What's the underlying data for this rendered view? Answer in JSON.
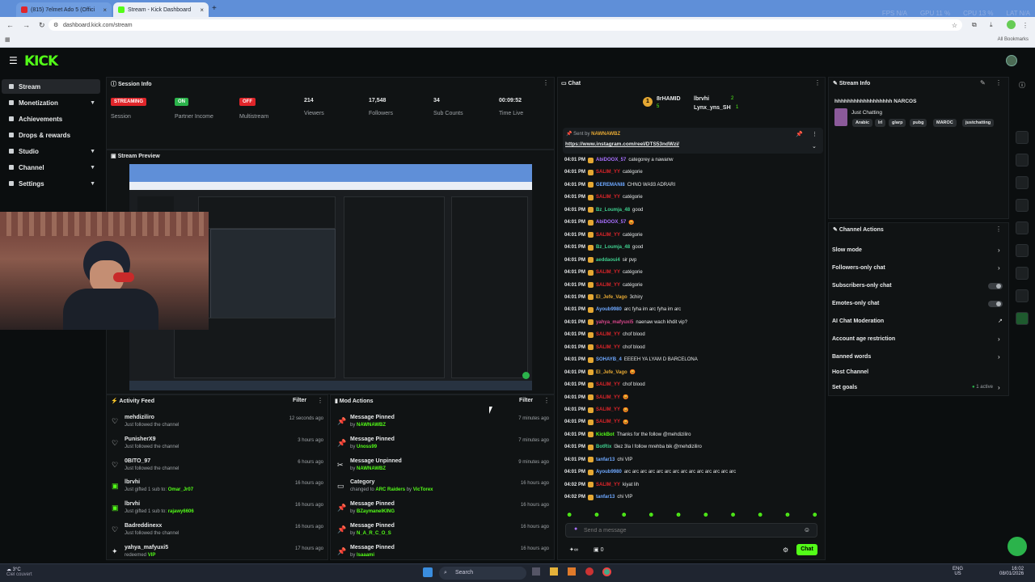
{
  "browser": {
    "tabs": [
      {
        "title": "(815) 7elmet Ado 5 (Offici",
        "active": false
      },
      {
        "title": "Stream - Kick Dashboard",
        "active": true
      }
    ],
    "hud": [
      "FPS N/A",
      "GPU 11 %",
      "CPU 13 %",
      "LAT N/A"
    ],
    "url": "dashboard.kick.com/stream",
    "all_bookmarks": "All Bookmarks"
  },
  "brand": {
    "logo": "KICK",
    "accent": "#53fc18"
  },
  "sidebar": {
    "items": [
      {
        "label": "Stream",
        "selected": true,
        "chevron": false
      },
      {
        "label": "Monetization",
        "chevron": true
      },
      {
        "label": "Achievements",
        "chevron": false
      },
      {
        "label": "Drops & rewards",
        "chevron": false
      },
      {
        "label": "Studio",
        "chevron": true
      },
      {
        "label": "Channel",
        "chevron": true
      },
      {
        "label": "Settings",
        "chevron": true
      }
    ]
  },
  "session": {
    "title": "Session Info",
    "stats": [
      {
        "badge": "STREAMING",
        "badge_color": "#e0252a",
        "label": "Session"
      },
      {
        "badge": "ON",
        "badge_color": "#2bb34b",
        "label": "Partner Income"
      },
      {
        "badge": "OFF",
        "badge_color": "#e0252a",
        "label": "Multistream"
      },
      {
        "value": "214",
        "label": "Viewers"
      },
      {
        "value": "17,548",
        "label": "Followers"
      },
      {
        "value": "34",
        "label": "Sub Counts"
      },
      {
        "value": "00:09:52",
        "label": "Time Live"
      }
    ]
  },
  "preview": {
    "title": "Stream Preview"
  },
  "activity": {
    "title": "Activity Feed",
    "filter": "Filter",
    "items": [
      {
        "icon": "heart",
        "name": "mehdiziliro",
        "sub": "Just followed the channel",
        "time": "12 seconds ago"
      },
      {
        "icon": "heart",
        "name": "PunisherX9",
        "sub": "Just followed the channel",
        "time": "3 hours ago"
      },
      {
        "icon": "heart",
        "name": "0BITO_97",
        "sub": "Just followed the channel",
        "time": "6 hours ago"
      },
      {
        "icon": "gift",
        "name": "lbrvhi",
        "sub_prefix": "Just gifted 1 sub to: ",
        "sub_target": "Omar_Jr07",
        "time": "16 hours ago"
      },
      {
        "icon": "gift",
        "name": "lbrvhi",
        "sub_prefix": "Just gifted 1 sub to: ",
        "sub_target": "rajawy6606",
        "time": "16 hours ago"
      },
      {
        "icon": "heart",
        "name": "Badreddinexx",
        "sub": "Just followed the channel",
        "time": "16 hours ago"
      },
      {
        "icon": "gift",
        "name": "yahya_mafyuxi5",
        "sub_prefix": "redeemed ",
        "sub_target": "VIP",
        "time": "17 hours ago"
      }
    ]
  },
  "mod": {
    "title": "Mod Actions",
    "filter": "Filter",
    "items": [
      {
        "icon": "pin",
        "name": "Message Pinned",
        "by": "by ",
        "target": "NAWNAWBZ",
        "time": "7 minutes ago"
      },
      {
        "icon": "pin",
        "name": "Message Pinned",
        "by": "by ",
        "target": "Unoss99",
        "time": "7 minutes ago"
      },
      {
        "icon": "unpin",
        "name": "Message Unpinned",
        "by": "by ",
        "target": "NAWNAWBZ",
        "time": "9 minutes ago"
      },
      {
        "icon": "category",
        "name": "Category",
        "by": "changed to ",
        "target": "ARC Raiders",
        "by2": " by ",
        "target2": "VicTorex",
        "time": "16 hours ago"
      },
      {
        "icon": "pin",
        "name": "Message Pinned",
        "by": "by ",
        "target": "BZaymanelKING",
        "time": "16 hours ago"
      },
      {
        "icon": "pin",
        "name": "Message Pinned",
        "by": "by ",
        "target": "N_A_R_C_O_S",
        "time": "16 hours ago"
      },
      {
        "icon": "pin",
        "name": "Message Pinned",
        "by": "by ",
        "target": "lsaaami",
        "time": "16 hours ago"
      }
    ]
  },
  "chat": {
    "title": "Chat",
    "top_gifter": {
      "rank": "1",
      "name": "8rHAMID",
      "count": "5"
    },
    "leader2": {
      "name": "lbrvhi",
      "count": "2"
    },
    "leader3": {
      "name": "Lynx_yns_SH",
      "count": "1"
    },
    "pinned_by": "Sent by",
    "pinned_user": "NAWNAWBZ",
    "pinned_link": "https://www.instagram.com/reel/DTS53ndWzi/",
    "messages": [
      {
        "t": "04:01 PM",
        "u": "AbiDOOX_57",
        "c": "#a970ff",
        "m": "categorey a nawanw"
      },
      {
        "t": "04:01 PM",
        "u": "SALIM_YY",
        "c": "#e0252a",
        "m": "catégorie"
      },
      {
        "t": "04:01 PM",
        "u": "GEREMANI8",
        "c": "#6ea8ff",
        "m": "CHNO WA93 ADRARI"
      },
      {
        "t": "04:01 PM",
        "u": "SALIM_YY",
        "c": "#e0252a",
        "m": "catégorie"
      },
      {
        "t": "04:01 PM",
        "u": "Bz_Loumja_48",
        "c": "#3fcf8e",
        "m": "good"
      },
      {
        "t": "04:01 PM",
        "u": "AbiDOOX_57",
        "c": "#a970ff",
        "m": "😡"
      },
      {
        "t": "04:01 PM",
        "u": "SALIM_YY",
        "c": "#e0252a",
        "m": "catégorie"
      },
      {
        "t": "04:01 PM",
        "u": "Bz_Loumja_48",
        "c": "#3fcf8e",
        "m": "good"
      },
      {
        "t": "04:01 PM",
        "u": "aeddaoui4",
        "c": "#3fcf8e",
        "m": "sir pvp"
      },
      {
        "t": "04:01 PM",
        "u": "SALIM_YY",
        "c": "#e0252a",
        "m": "catégorie"
      },
      {
        "t": "04:01 PM",
        "u": "SALIM_YY",
        "c": "#e0252a",
        "m": "catégorie"
      },
      {
        "t": "04:01 PM",
        "u": "El_Jefe_Vago",
        "c": "#e5a833",
        "m": "3chiry"
      },
      {
        "t": "04:01 PM",
        "u": "Ayoub9980",
        "c": "#6ea8ff",
        "m": "arc fyha im arc fyha im arc"
      },
      {
        "t": "04:01 PM",
        "u": "yahya_mafyuxi5",
        "c": "#d9468b",
        "m": "naenaw wach khdit vip?"
      },
      {
        "t": "04:01 PM",
        "u": "SALIM_YY",
        "c": "#e0252a",
        "m": "chof blood"
      },
      {
        "t": "04:01 PM",
        "u": "SALIM_YY",
        "c": "#e0252a",
        "m": "chof blood"
      },
      {
        "t": "04:01 PM",
        "u": "SOHAYB_4",
        "c": "#6ea8ff",
        "m": "EEEEH YA LYAM D BARCELONA"
      },
      {
        "t": "04:01 PM",
        "u": "El_Jefe_Vago",
        "c": "#e5a833",
        "m": "😡"
      },
      {
        "t": "04:01 PM",
        "u": "SALIM_YY",
        "c": "#e0252a",
        "m": "chof blood"
      },
      {
        "t": "04:01 PM",
        "u": "SALIM_YY",
        "c": "#e0252a",
        "m": "😡"
      },
      {
        "t": "04:01 PM",
        "u": "SALIM_YY",
        "c": "#e0252a",
        "m": "😡"
      },
      {
        "t": "04:01 PM",
        "u": "SALIM_YY",
        "c": "#e0252a",
        "m": "😡"
      },
      {
        "t": "04:01 PM",
        "u": "KickBot",
        "c": "#53fc18",
        "m": "Thanks for the follow @mehdiziliro"
      },
      {
        "t": "04:01 PM",
        "u": "BotRix",
        "c": "#3fcf8e",
        "m": "l3ez 3la l follow mrehba bik @mehdiziliro"
      },
      {
        "t": "04:01 PM",
        "u": "tanfar13",
        "c": "#6ea8ff",
        "m": "chi VIP"
      },
      {
        "t": "04:01 PM",
        "u": "Ayoub9980",
        "c": "#6ea8ff",
        "m": "arc arc arc arc arc arc arc arc arc arc arc arc arc arc"
      },
      {
        "t": "04:02 PM",
        "u": "SALIM_YY",
        "c": "#e0252a",
        "m": "kiyat lih"
      },
      {
        "t": "04:02 PM",
        "u": "tanfar13",
        "c": "#6ea8ff",
        "m": "chi VIP"
      }
    ],
    "input_placeholder": "Send a message",
    "send_label": "Chat",
    "count": "0"
  },
  "stream_info": {
    "title": "Stream Info",
    "stream_title": "hhhhhhhhhhhhhhhhhh NARCOS",
    "category": "Just Chatting",
    "tags": [
      "Arabic",
      "lrl",
      "glarp",
      "pubg",
      "MAROC",
      "justchatting"
    ]
  },
  "channel_actions": {
    "title": "Channel Actions",
    "items": [
      {
        "label": "Slow mode",
        "control": "arrow"
      },
      {
        "label": "Followers-only chat",
        "control": "arrow"
      },
      {
        "label": "Subscribers-only chat",
        "control": "toggle"
      },
      {
        "label": "Emotes-only chat",
        "control": "toggle"
      },
      {
        "label": "AI Chat Moderation",
        "control": "link"
      },
      {
        "label": "Account age restriction",
        "control": "arrow"
      },
      {
        "label": "Banned words",
        "control": "arrow"
      },
      {
        "label": "Host Channel",
        "control": "none"
      },
      {
        "label": "Set goals",
        "control": "arrow",
        "status": "1 active"
      }
    ]
  },
  "taskbar": {
    "weather": "3°C",
    "weather_sub": "Ciel couvert",
    "search": "Search",
    "lang": "ENG",
    "region": "US",
    "time": "16:02",
    "date": "08/01/2026"
  }
}
